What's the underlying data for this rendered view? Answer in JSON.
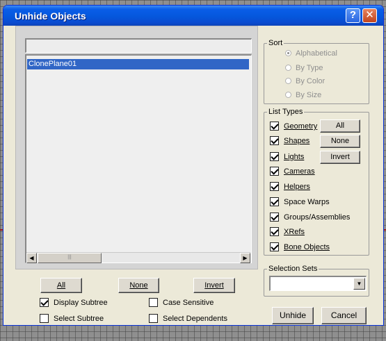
{
  "window": {
    "title": "Unhide Objects",
    "help_glyph": "?",
    "close_glyph": "✕"
  },
  "list": {
    "filter_value": "",
    "items": [
      "ClonePlane01"
    ],
    "scroll_left": "◀",
    "scroll_right": "▶",
    "thumb_grip": "|||"
  },
  "bottom_buttons": {
    "all": "All",
    "none": "None",
    "invert": "Invert"
  },
  "options": {
    "display_subtree": {
      "label": "Display Subtree",
      "checked": true
    },
    "case_sensitive": {
      "label": "Case Sensitive",
      "checked": false
    },
    "select_subtree": {
      "label": "Select Subtree",
      "checked": false
    },
    "select_dependents": {
      "label": "Select Dependents",
      "checked": false
    }
  },
  "sort": {
    "label": "Sort",
    "options": [
      {
        "label": "Alphabetical",
        "selected": true
      },
      {
        "label": "By Type",
        "selected": false
      },
      {
        "label": "By Color",
        "selected": false
      },
      {
        "label": "By Size",
        "selected": false
      }
    ]
  },
  "list_types": {
    "label": "List Types",
    "items": [
      {
        "label": "Geometry",
        "checked": true
      },
      {
        "label": "Shapes",
        "checked": true
      },
      {
        "label": "Lights",
        "checked": true
      },
      {
        "label": "Cameras",
        "checked": true
      },
      {
        "label": "Helpers",
        "checked": true
      },
      {
        "label": "Space Warps",
        "checked": true
      },
      {
        "label": "Groups/Assemblies",
        "checked": true
      },
      {
        "label": "XRefs",
        "checked": true
      },
      {
        "label": "Bone Objects",
        "checked": true
      }
    ],
    "buttons": {
      "all": "All",
      "none": "None",
      "invert": "Invert"
    }
  },
  "selection_sets": {
    "label": "Selection Sets",
    "value": "",
    "arrow": "▼"
  },
  "actions": {
    "unhide": "Unhide",
    "cancel": "Cancel"
  },
  "colors": {
    "title_bar": "#0a5ee8",
    "selection": "#3166c6",
    "dialog_face": "#ece9d8"
  }
}
